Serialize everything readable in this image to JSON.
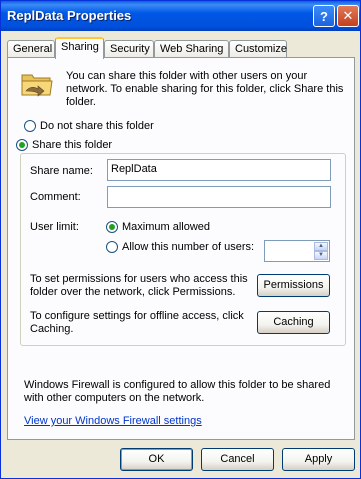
{
  "window": {
    "title": "ReplData Properties",
    "help_glyph": "?",
    "close_glyph": "✕"
  },
  "tabs": [
    {
      "label": "General",
      "active": false
    },
    {
      "label": "Sharing",
      "active": true
    },
    {
      "label": "Security",
      "active": false
    },
    {
      "label": "Web Sharing",
      "active": false
    },
    {
      "label": "Customize",
      "active": false
    }
  ],
  "sharing": {
    "icon": "shared-folder-icon",
    "intro": "You can share this folder with other users on your network.  To enable sharing for this folder, click Share this folder.",
    "do_not_share_label": "Do not share this folder",
    "share_label": "Share this folder",
    "share_selected": true,
    "share_name_label": "Share name:",
    "share_name_value": "ReplData",
    "comment_label": "Comment:",
    "comment_value": "",
    "user_limit_label": "User limit:",
    "max_allowed_label": "Maximum allowed",
    "max_allowed_selected": true,
    "allow_number_label": "Allow this number of users:",
    "allow_number_value": "",
    "permissions_text": "To set permissions for users who access this folder over the network, click Permissions.",
    "permissions_button": "Permissions",
    "caching_text": "To configure settings for offline access, click Caching.",
    "caching_button": "Caching",
    "firewall_text": "Windows Firewall is configured to allow this folder to be shared with other computers on the network.",
    "firewall_link": "View your Windows Firewall settings"
  },
  "footer": {
    "ok": "OK",
    "cancel": "Cancel",
    "apply": "Apply"
  },
  "colors": {
    "titlebar": "#0058e6",
    "dialog_bg": "#ece9d8",
    "panel_bg": "#fcfcfe",
    "link": "#0033cc",
    "radio_dot": "#21a121"
  }
}
